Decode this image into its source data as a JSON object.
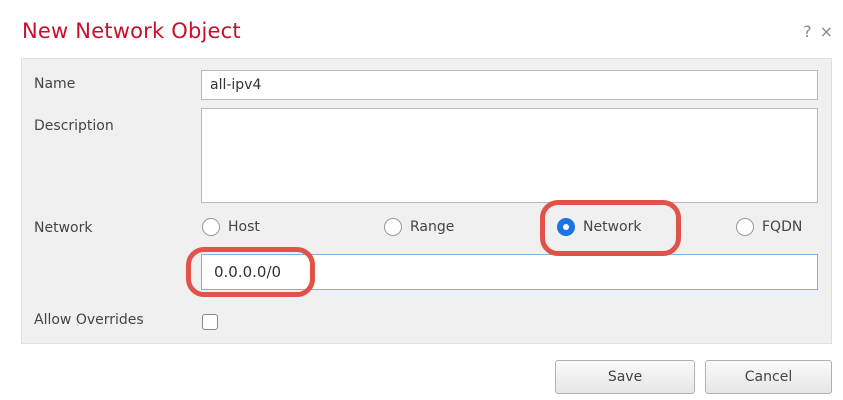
{
  "dialog": {
    "title": "New Network Object",
    "help_glyph": "?",
    "close_glyph": "×"
  },
  "form": {
    "name_label": "Name",
    "name_value": "all-ipv4",
    "description_label": "Description",
    "description_value": "",
    "network_label": "Network",
    "network_value": "0.0.0.0/0",
    "allow_overrides_label": "Allow Overrides",
    "allow_overrides_checked": false,
    "network_types": [
      {
        "label": "Host",
        "selected": false
      },
      {
        "label": "Range",
        "selected": false
      },
      {
        "label": "Network",
        "selected": true
      },
      {
        "label": "FQDN",
        "selected": false
      }
    ]
  },
  "buttons": {
    "save_label": "Save",
    "cancel_label": "Cancel"
  },
  "colors": {
    "title": "#c8102e",
    "accent": "#1b73e8",
    "highlight": "#e0524a"
  }
}
